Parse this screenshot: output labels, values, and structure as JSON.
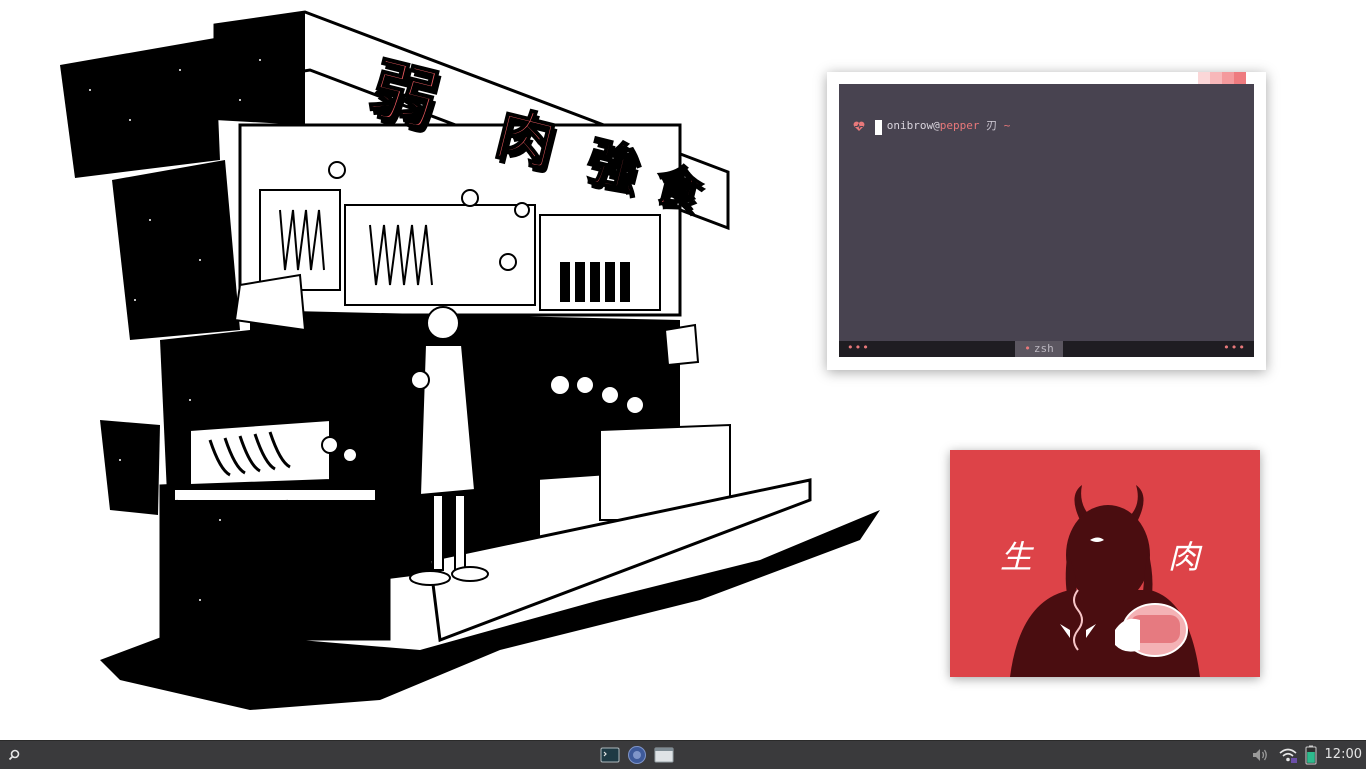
{
  "colors": {
    "accent": "#e8585e",
    "terminal_bg": "#484350",
    "terminal_status_bg": "#1f1d22",
    "artwork_bg": "#dd4348",
    "taskbar_bg": "#3a3a3c"
  },
  "wallpaper": {
    "sign_chars": [
      "弱",
      "肉",
      "強",
      "食"
    ]
  },
  "terminal": {
    "prompt_user": "onibrow",
    "prompt_at": "@",
    "prompt_host": "pepper",
    "prompt_symbol": "刃",
    "prompt_dir": "~",
    "status_left": "•••",
    "status_right": "•••",
    "active_tab_marker": "•",
    "active_tab": "zsh"
  },
  "artwork": {
    "left_char": "生",
    "right_char": "肉"
  },
  "taskbar": {
    "launcher_icon": "search-icon",
    "apps": [
      "terminal-icon",
      "browser-icon",
      "files-icon"
    ],
    "tray_icons": [
      "volume-icon",
      "wifi-icon",
      "battery-icon"
    ],
    "clock": "12:00"
  }
}
